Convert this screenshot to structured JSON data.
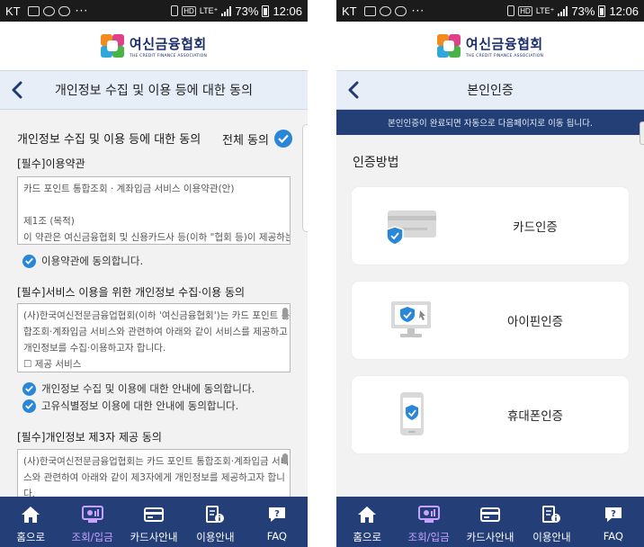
{
  "colors": {
    "navy": "#243e78",
    "notice_bar": "#233f76",
    "check_blue": "#2a87d8",
    "active_nav": "#c9a2ff",
    "title_bg": "#e7eef8"
  },
  "status_bar": {
    "carrier": "KT",
    "dots": "···",
    "hd": "HD",
    "lte": "LTE⁺",
    "battery": "73%",
    "time": "12:06"
  },
  "logo": {
    "name_kr": "여신금융협회",
    "name_en": "THE CREDIT FINANCE ASSOCIATION"
  },
  "left_screen": {
    "title": "개인정보 수집 및 이용 등에 대한 동의",
    "section_title": "개인정보 수집 및 이용 등에 대한 동의",
    "all_agree": "전체 동의",
    "sections": [
      {
        "label": "[필수]이용약관",
        "text": [
          "카드 포인트 통합조회 · 계좌입금 서비스 이용약관(안)",
          "",
          "제1조 (목적)",
          "이 약관은 여신금융협회 및 신용카드사 등(이하 \"협회 등)이 제공하는"
        ],
        "agreements": [
          "이용약관에 동의합니다."
        ]
      },
      {
        "label": "[필수]서비스 이용을 위한 개인정보 수집·이용 동의",
        "text": [
          "(사)한국여신전문금융업협회(이하 '여신금융협회')는 카드 포인트 통",
          "합조회·계좌입금 서비스와 관련하여 아래와 같이 서비스를 제공하고",
          "개인정보를 수집·이용하고자 합니다.",
          "☐ 제공 서비스"
        ],
        "agreements": [
          "개인정보 수집 및 이용에 대한 안내에 동의합니다.",
          "고유식별정보 이용에 대한 안내에 동의합니다."
        ]
      },
      {
        "label": "[필수]개인정보 제3자 제공 동의",
        "text": [
          "(사)한국여신전문금융업협회는 카드 포인트 통합조회·계좌입금 서비",
          "스와 관련하여 아래와 같이 제3자에게 개인정보를 제공하고자 합니",
          "다."
        ],
        "agreements": []
      }
    ]
  },
  "right_screen": {
    "title": "본인인증",
    "notice": "본인인증이 완료되면 자동으로 다음페이지로 이동 됩니다.",
    "method_title": "인증방법",
    "methods": [
      {
        "label": "카드인증",
        "icon": "card-shield-icon"
      },
      {
        "label": "아이핀인증",
        "icon": "monitor-shield-icon"
      },
      {
        "label": "휴대폰인증",
        "icon": "phone-shield-icon"
      }
    ]
  },
  "bottom_nav": [
    {
      "label": "홈으로",
      "icon": "home-icon",
      "active": false
    },
    {
      "label": "조회/입금",
      "icon": "inquiry-icon",
      "active": true
    },
    {
      "label": "카드사안내",
      "icon": "card-icon",
      "active": false
    },
    {
      "label": "이용안내",
      "icon": "guide-icon",
      "active": false
    },
    {
      "label": "FAQ",
      "icon": "faq-icon",
      "active": false
    }
  ]
}
